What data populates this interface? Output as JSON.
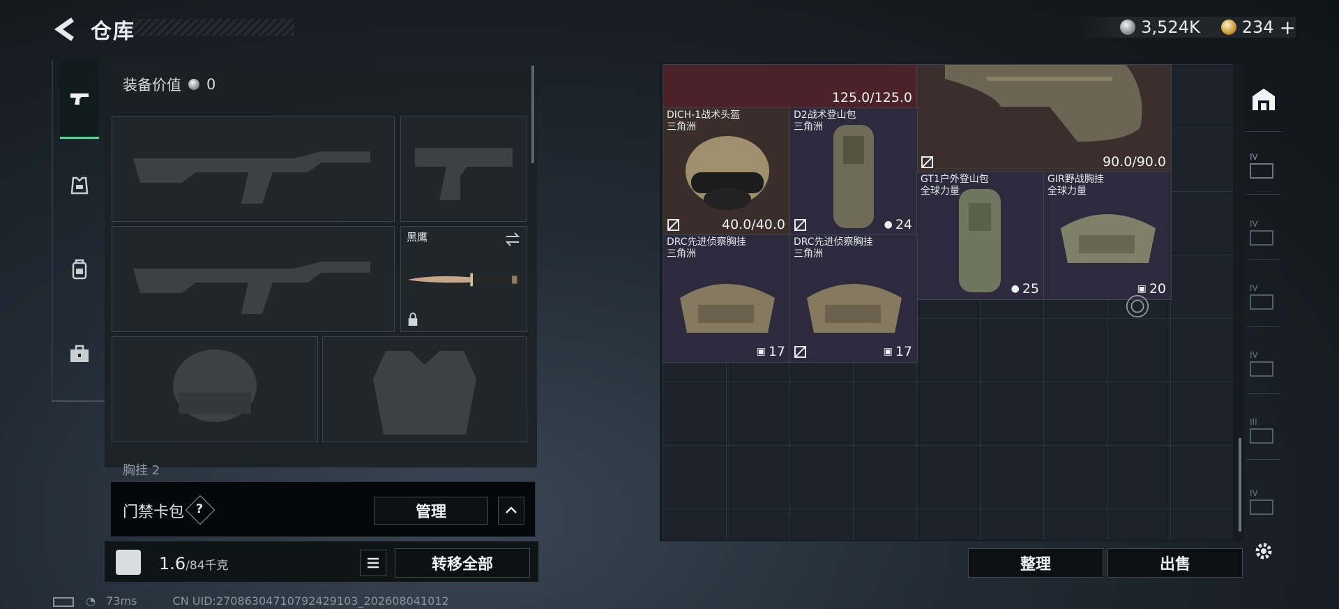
{
  "header": {
    "title": "仓库"
  },
  "currency": {
    "silver": "3,524K",
    "gold": "234",
    "gold_plus": "+"
  },
  "equipment": {
    "value_label": "装备价值",
    "value": "0",
    "knife_name": "黑鹰",
    "chest_hint": "胸挂",
    "chest_count": "2"
  },
  "keycard": {
    "label": "门禁卡包",
    "help": "?",
    "manage_label": "管理"
  },
  "weight": {
    "current": "1.6",
    "max": "/84千克"
  },
  "actions": {
    "transfer_all": "转移全部",
    "sort": "整理",
    "sell": "出售"
  },
  "storage": {
    "top_left_durability": "125.0/125.0",
    "armor_durability": "90.0/90.0",
    "items": [
      {
        "name": "DICH-1战术头盔",
        "origin": "三角洲",
        "value": "40.0/40.0"
      },
      {
        "name": "D2战术登山包",
        "origin": "三角洲",
        "value": "24"
      },
      {
        "name": "GT1户外登山包",
        "origin": "全球力量",
        "value": "25"
      },
      {
        "name": "GIR野战胸挂",
        "origin": "全球力量",
        "value": "20"
      },
      {
        "name": "DRC先进侦察胸挂",
        "origin": "三角洲",
        "value": "17"
      },
      {
        "name": "DRC先进侦察胸挂",
        "origin": "三角洲",
        "value": "17"
      }
    ]
  },
  "side_tiers": [
    "IV",
    "IV",
    "IV",
    "IV",
    "III",
    "IV"
  ],
  "status": {
    "ping": "73ms",
    "uid": "CN UID:27086304710792429103_202608041012"
  },
  "colors": {
    "accent": "#58d39a",
    "rare_red": "#5a2328",
    "item_purple": "#2c2a3c"
  }
}
